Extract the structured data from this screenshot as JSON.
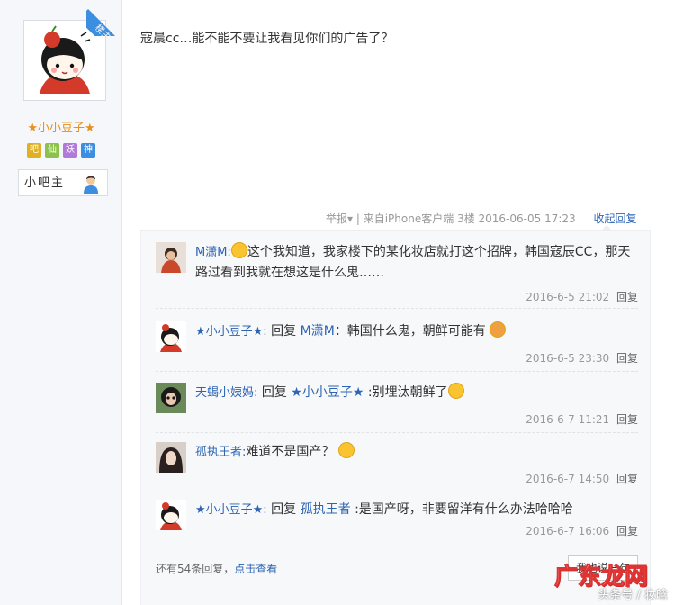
{
  "author": {
    "name": "★小小豆子★",
    "louzhu_label": "楼主",
    "badges": [
      {
        "label": "吧",
        "color": "#e0b020"
      },
      {
        "label": "仙",
        "color": "#8bc34a"
      },
      {
        "label": "妖",
        "color": "#b27ad8"
      },
      {
        "label": "神",
        "color": "#3c8ee0"
      }
    ],
    "role_label": "小吧主"
  },
  "post": {
    "text": "寇晨cc…能不能不要让我看见你们的广告了？",
    "report_label": "举报▾",
    "source": "| 来自iPhone客户端",
    "floor": "3楼",
    "datetime": "2016-06-05 17:23",
    "collapse_label": "收起回复"
  },
  "replies": [
    {
      "name": "M潇M:",
      "prefix": "",
      "target": "",
      "text": "这个我知道，我家楼下的某化妆店就打这个招牌，韩国寇辰CC，那天路过看到我就在想这是什么鬼……",
      "time": "2016-6-5 21:02",
      "reply_label": "回复"
    },
    {
      "name": "★小小豆子★:",
      "prefix": "回复",
      "target": "M潇M",
      "text": "：韩国什么鬼，朝鲜可能有",
      "time": "2016-6-5 23:30",
      "reply_label": "回复"
    },
    {
      "name": "天蝎小姨妈:",
      "prefix": "回复",
      "target": "★小小豆子★",
      "text": ":别埋汰朝鲜了",
      "time": "2016-6-7 11:21",
      "reply_label": "回复"
    },
    {
      "name": "孤执王者:",
      "prefix": "",
      "target": "",
      "text": "难道不是国产？",
      "time": "2016-6-7 14:50",
      "reply_label": "回复"
    },
    {
      "name": "★小小豆子★:",
      "prefix": "回复",
      "target": "孤执王者",
      "text": ":是国产呀，非要留洋有什么办法哈哈哈",
      "time": "2016-6-7 16:06",
      "reply_label": "回复"
    }
  ],
  "footer": {
    "more_text": "还有54条回复，",
    "view_label": "点击查看",
    "say_button": "我也说一句"
  },
  "watermark": {
    "brand": "广东龙网",
    "sub": "头条号 / 妆晗"
  }
}
